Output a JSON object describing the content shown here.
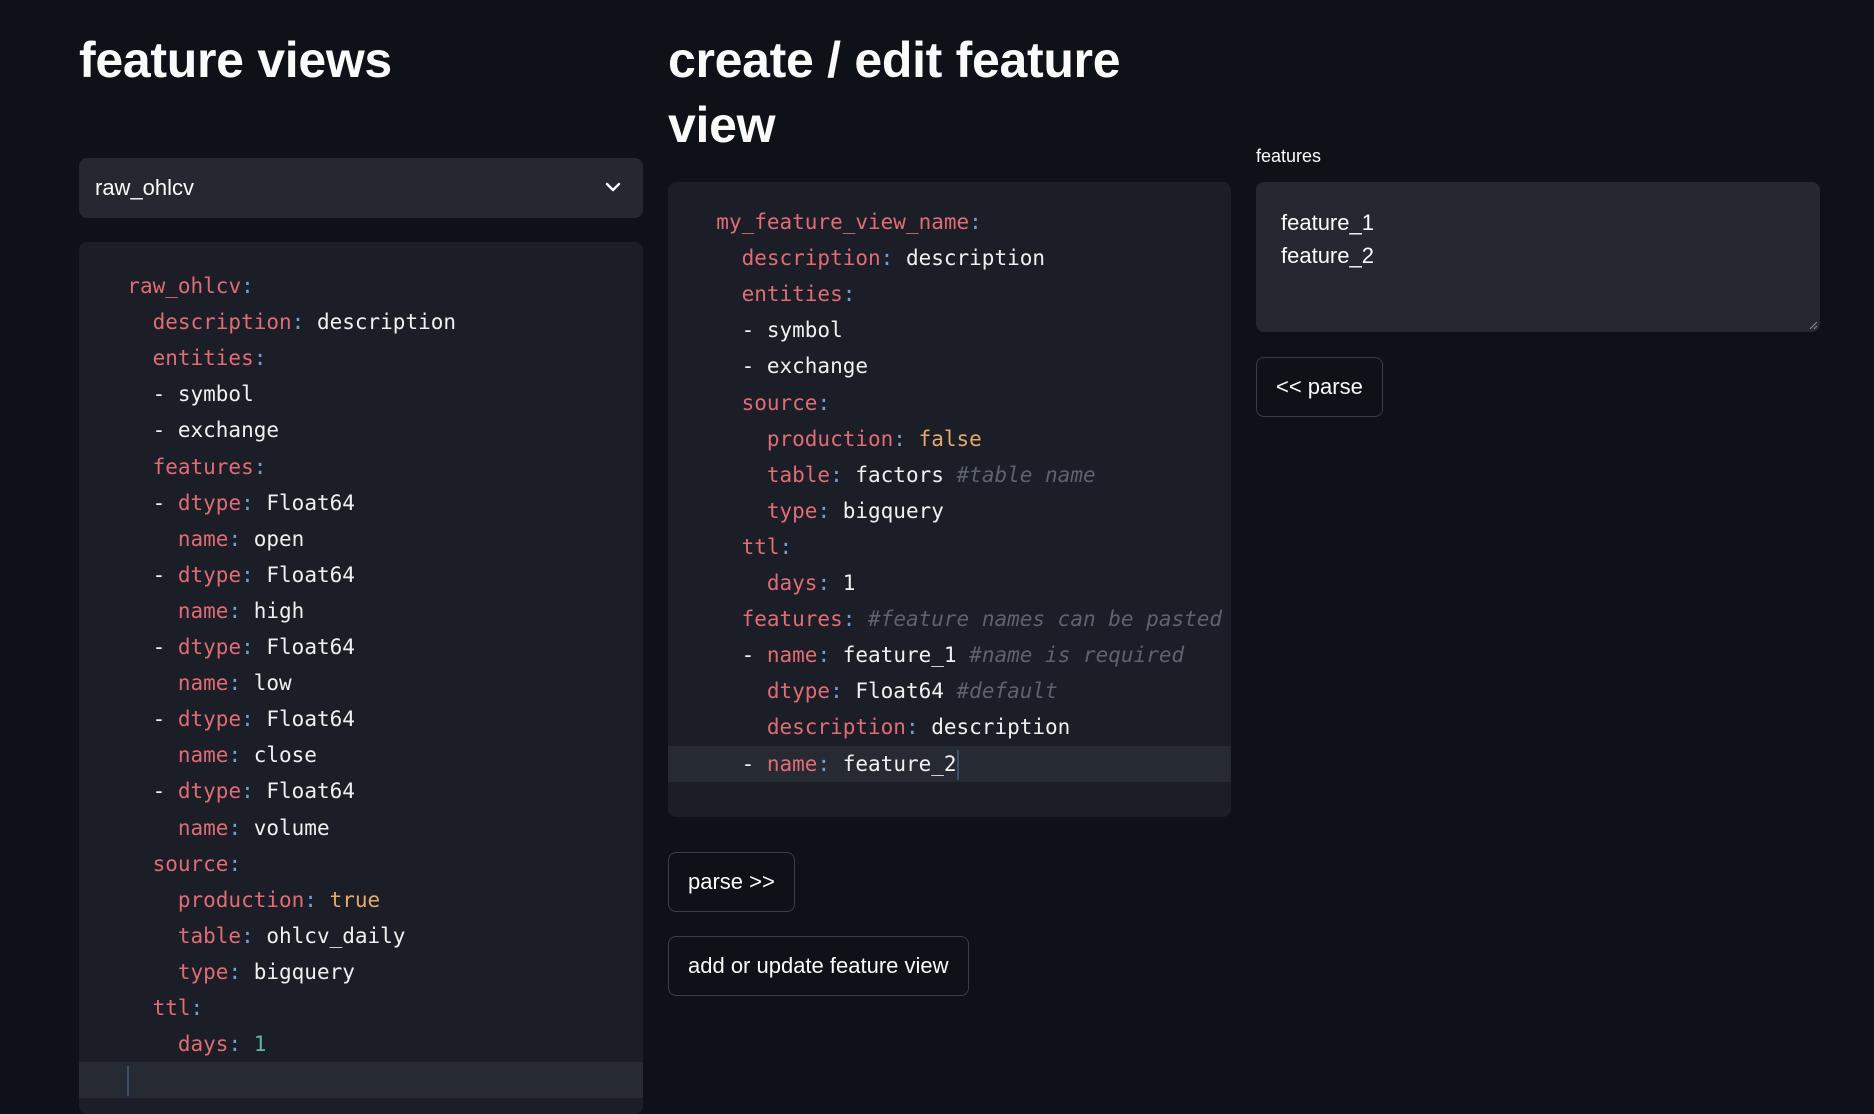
{
  "left": {
    "title": "feature views",
    "select_value": "raw_ohlcv",
    "lines": [
      {
        "indent": "  ",
        "parts": [
          [
            "k",
            "raw_ohlcv"
          ],
          [
            "p",
            ":"
          ]
        ]
      },
      {
        "indent": "    ",
        "parts": [
          [
            "k",
            "description"
          ],
          [
            "p",
            ": "
          ],
          [
            "v",
            "description"
          ]
        ]
      },
      {
        "indent": "    ",
        "parts": [
          [
            "k",
            "entities"
          ],
          [
            "p",
            ":"
          ]
        ]
      },
      {
        "indent": "    ",
        "parts": [
          [
            "v",
            "- symbol"
          ]
        ]
      },
      {
        "indent": "    ",
        "parts": [
          [
            "v",
            "- exchange"
          ]
        ]
      },
      {
        "indent": "    ",
        "parts": [
          [
            "k",
            "features"
          ],
          [
            "p",
            ":"
          ]
        ]
      },
      {
        "indent": "    ",
        "parts": [
          [
            "v",
            "- "
          ],
          [
            "k",
            "dtype"
          ],
          [
            "p",
            ": "
          ],
          [
            "v",
            "Float64"
          ]
        ]
      },
      {
        "indent": "      ",
        "parts": [
          [
            "k",
            "name"
          ],
          [
            "p",
            ": "
          ],
          [
            "v",
            "open"
          ]
        ]
      },
      {
        "indent": "    ",
        "parts": [
          [
            "v",
            "- "
          ],
          [
            "k",
            "dtype"
          ],
          [
            "p",
            ": "
          ],
          [
            "v",
            "Float64"
          ]
        ]
      },
      {
        "indent": "      ",
        "parts": [
          [
            "k",
            "name"
          ],
          [
            "p",
            ": "
          ],
          [
            "v",
            "high"
          ]
        ]
      },
      {
        "indent": "    ",
        "parts": [
          [
            "v",
            "- "
          ],
          [
            "k",
            "dtype"
          ],
          [
            "p",
            ": "
          ],
          [
            "v",
            "Float64"
          ]
        ]
      },
      {
        "indent": "      ",
        "parts": [
          [
            "k",
            "name"
          ],
          [
            "p",
            ": "
          ],
          [
            "v",
            "low"
          ]
        ]
      },
      {
        "indent": "    ",
        "parts": [
          [
            "v",
            "- "
          ],
          [
            "k",
            "dtype"
          ],
          [
            "p",
            ": "
          ],
          [
            "v",
            "Float64"
          ]
        ]
      },
      {
        "indent": "      ",
        "parts": [
          [
            "k",
            "name"
          ],
          [
            "p",
            ": "
          ],
          [
            "v",
            "close"
          ]
        ]
      },
      {
        "indent": "    ",
        "parts": [
          [
            "v",
            "- "
          ],
          [
            "k",
            "dtype"
          ],
          [
            "p",
            ": "
          ],
          [
            "v",
            "Float64"
          ]
        ]
      },
      {
        "indent": "      ",
        "parts": [
          [
            "k",
            "name"
          ],
          [
            "p",
            ": "
          ],
          [
            "v",
            "volume"
          ]
        ]
      },
      {
        "indent": "    ",
        "parts": [
          [
            "k",
            "source"
          ],
          [
            "p",
            ":"
          ]
        ]
      },
      {
        "indent": "      ",
        "parts": [
          [
            "k",
            "production"
          ],
          [
            "p",
            ": "
          ],
          [
            "b",
            "true"
          ]
        ]
      },
      {
        "indent": "      ",
        "parts": [
          [
            "k",
            "table"
          ],
          [
            "p",
            ": "
          ],
          [
            "v",
            "ohlcv_daily"
          ]
        ]
      },
      {
        "indent": "      ",
        "parts": [
          [
            "k",
            "type"
          ],
          [
            "p",
            ": "
          ],
          [
            "v",
            "bigquery"
          ]
        ]
      },
      {
        "indent": "    ",
        "parts": [
          [
            "k",
            "ttl"
          ],
          [
            "p",
            ":"
          ]
        ]
      },
      {
        "indent": "      ",
        "parts": [
          [
            "k",
            "days"
          ],
          [
            "p",
            ": "
          ],
          [
            "n",
            "1"
          ]
        ]
      },
      {
        "indent": "  ",
        "parts": [],
        "active": true,
        "cursor": true
      }
    ]
  },
  "middle": {
    "title": "create / edit feature view",
    "lines": [
      {
        "indent": "  ",
        "parts": [
          [
            "k",
            "my_feature_view_name"
          ],
          [
            "p",
            ":"
          ]
        ]
      },
      {
        "indent": "    ",
        "parts": [
          [
            "k",
            "description"
          ],
          [
            "p",
            ": "
          ],
          [
            "v",
            "description"
          ]
        ]
      },
      {
        "indent": "    ",
        "parts": [
          [
            "k",
            "entities"
          ],
          [
            "p",
            ":"
          ]
        ]
      },
      {
        "indent": "    ",
        "parts": [
          [
            "v",
            "- symbol"
          ]
        ]
      },
      {
        "indent": "    ",
        "parts": [
          [
            "v",
            "- exchange"
          ]
        ]
      },
      {
        "indent": "    ",
        "parts": [
          [
            "k",
            "source"
          ],
          [
            "p",
            ":"
          ]
        ]
      },
      {
        "indent": "      ",
        "parts": [
          [
            "k",
            "production"
          ],
          [
            "p",
            ": "
          ],
          [
            "b",
            "false"
          ]
        ]
      },
      {
        "indent": "      ",
        "parts": [
          [
            "k",
            "table"
          ],
          [
            "p",
            ": "
          ],
          [
            "v",
            "factors "
          ],
          [
            "c",
            "#table name"
          ]
        ]
      },
      {
        "indent": "      ",
        "parts": [
          [
            "k",
            "type"
          ],
          [
            "p",
            ": "
          ],
          [
            "v",
            "bigquery"
          ]
        ]
      },
      {
        "indent": "    ",
        "parts": [
          [
            "k",
            "ttl"
          ],
          [
            "p",
            ":"
          ]
        ]
      },
      {
        "indent": "      ",
        "parts": [
          [
            "k",
            "days"
          ],
          [
            "p",
            ": "
          ],
          [
            "v",
            "1"
          ]
        ]
      },
      {
        "indent": "    ",
        "parts": [
          [
            "k",
            "features"
          ],
          [
            "p",
            ": "
          ],
          [
            "c",
            "#feature names can be pasted"
          ]
        ]
      },
      {
        "indent": "    ",
        "parts": [
          [
            "v",
            "- "
          ],
          [
            "k",
            "name"
          ],
          [
            "p",
            ": "
          ],
          [
            "v",
            "feature_1 "
          ],
          [
            "c",
            "#name is required"
          ]
        ]
      },
      {
        "indent": "      ",
        "parts": [
          [
            "k",
            "dtype"
          ],
          [
            "p",
            ": "
          ],
          [
            "v",
            "Float64 "
          ],
          [
            "c",
            "#default"
          ]
        ]
      },
      {
        "indent": "      ",
        "parts": [
          [
            "k",
            "description"
          ],
          [
            "p",
            ": "
          ],
          [
            "v",
            "description"
          ]
        ]
      },
      {
        "indent": "    ",
        "parts": [
          [
            "v",
            "- "
          ],
          [
            "k",
            "name"
          ],
          [
            "p",
            ": "
          ],
          [
            "v",
            "feature_2"
          ]
        ],
        "active": true,
        "cursor": true
      }
    ],
    "parse_button": "parse >>",
    "add_button": "add or update feature view"
  },
  "right": {
    "field_label": "features",
    "textarea_value": "feature_1\nfeature_2",
    "parse_button": "<< parse"
  },
  "colors": {
    "background": "#0e1117",
    "input_bg": "#262730",
    "code_bg": "#1b1e26",
    "key": "#e06c75",
    "punct": "#6f9fd3",
    "bool": "#e5a96b",
    "number": "#5fb7a0",
    "comment": "#5c6370"
  }
}
